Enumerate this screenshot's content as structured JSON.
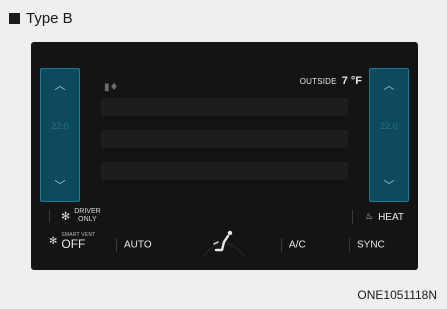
{
  "heading": {
    "text": "Type B"
  },
  "display": {
    "outside": {
      "label": "OUTSIDE",
      "value": "7 °F"
    },
    "driver_only": {
      "line1": "DRIVER",
      "line2": "ONLY"
    },
    "heat": {
      "label": "HEAT"
    },
    "smart_vent": {
      "small": "SMART VENT",
      "value": "OFF"
    },
    "auto": {
      "label": "AUTO"
    },
    "ac": {
      "label": "A/C"
    },
    "sync": {
      "label": "SYNC"
    },
    "left_temp_dim": "22.0",
    "right_temp_dim": "22.0"
  },
  "figure_code": "ONE1051118N",
  "colors": {
    "panel": "#141414",
    "side_panel": "#0d4a5e",
    "side_border": "#1c7a96",
    "accent_text": "#e8e8e8"
  }
}
